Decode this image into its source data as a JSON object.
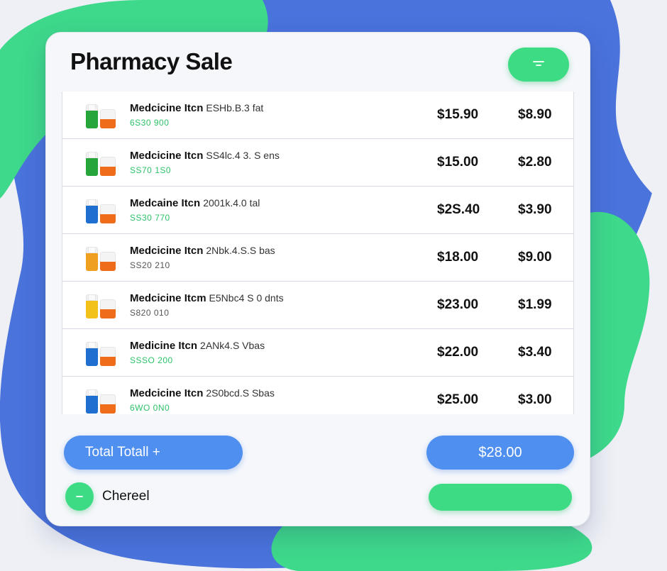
{
  "title": "Pharmacy Sale",
  "colors": {
    "accent_blue": "#4f8ff0",
    "accent_green": "#3ddc84",
    "text_green": "#2ec26a",
    "bg_blob_blue": "#4a73dc",
    "bg_blob_green": "#3ed98a"
  },
  "toolbar": {
    "filter_icon": "filter-icon"
  },
  "items": [
    {
      "name": "Medcicine Itcn",
      "detail": "ESHb.B.3 fat",
      "sub": "6S30 900",
      "sub_color": "#2ec26a",
      "price": "$15.90",
      "extra": "$8.90",
      "bottle_color": "#26a53b",
      "jar_color": "#ef6c1a"
    },
    {
      "name": "Medcicine Itcn",
      "detail": "SS4lc.4 3. S ens",
      "sub": "SS70 1S0",
      "sub_color": "#2ec26a",
      "price": "$15.00",
      "extra": "$2.80",
      "bottle_color": "#26a53b",
      "jar_color": "#ef6c1a"
    },
    {
      "name": "Medcaine Itcn",
      "detail": "2001k.4.0 tal",
      "sub": "SS30 770",
      "sub_color": "#2ec26a",
      "price": "$2S.40",
      "extra": "$3.90",
      "bottle_color": "#1e6fd0",
      "jar_color": "#ef6c1a"
    },
    {
      "name": "Medcicine Itcn",
      "detail": "2Nbk.4.S.S bas",
      "sub": "SS20 210",
      "sub_color": "#555555",
      "price": "$18.00",
      "extra": "$9.00",
      "bottle_color": "#f0a020",
      "jar_color": "#ef6c1a"
    },
    {
      "name": "Medcicine Itcm",
      "detail": "E5Nbc4 S 0 dnts",
      "sub": "S820 010",
      "sub_color": "#555555",
      "price": "$23.00",
      "extra": "$1.99",
      "bottle_color": "#f2c21b",
      "jar_color": "#ef6c1a"
    },
    {
      "name": "Medicine Itcn",
      "detail": "2ANk4.S Vbas",
      "sub": "SSSO 200",
      "sub_color": "#2ec26a",
      "price": "$22.00",
      "extra": "$3.40",
      "bottle_color": "#1e6fd0",
      "jar_color": "#ef6c1a"
    },
    {
      "name": "Medcicine Itcn",
      "detail": "2S0bcd.S Sbas",
      "sub": "6WO 0N0",
      "sub_color": "#2ec26a",
      "price": "$25.00",
      "extra": "$3.00",
      "bottle_color": "#1e6fd0",
      "jar_color": "#ef6c1a"
    }
  ],
  "footer": {
    "total_label": "Total Totall +",
    "total_amount": "$28.00",
    "cancel_label": "Chereel",
    "cancel_icon": "minus-icon"
  }
}
